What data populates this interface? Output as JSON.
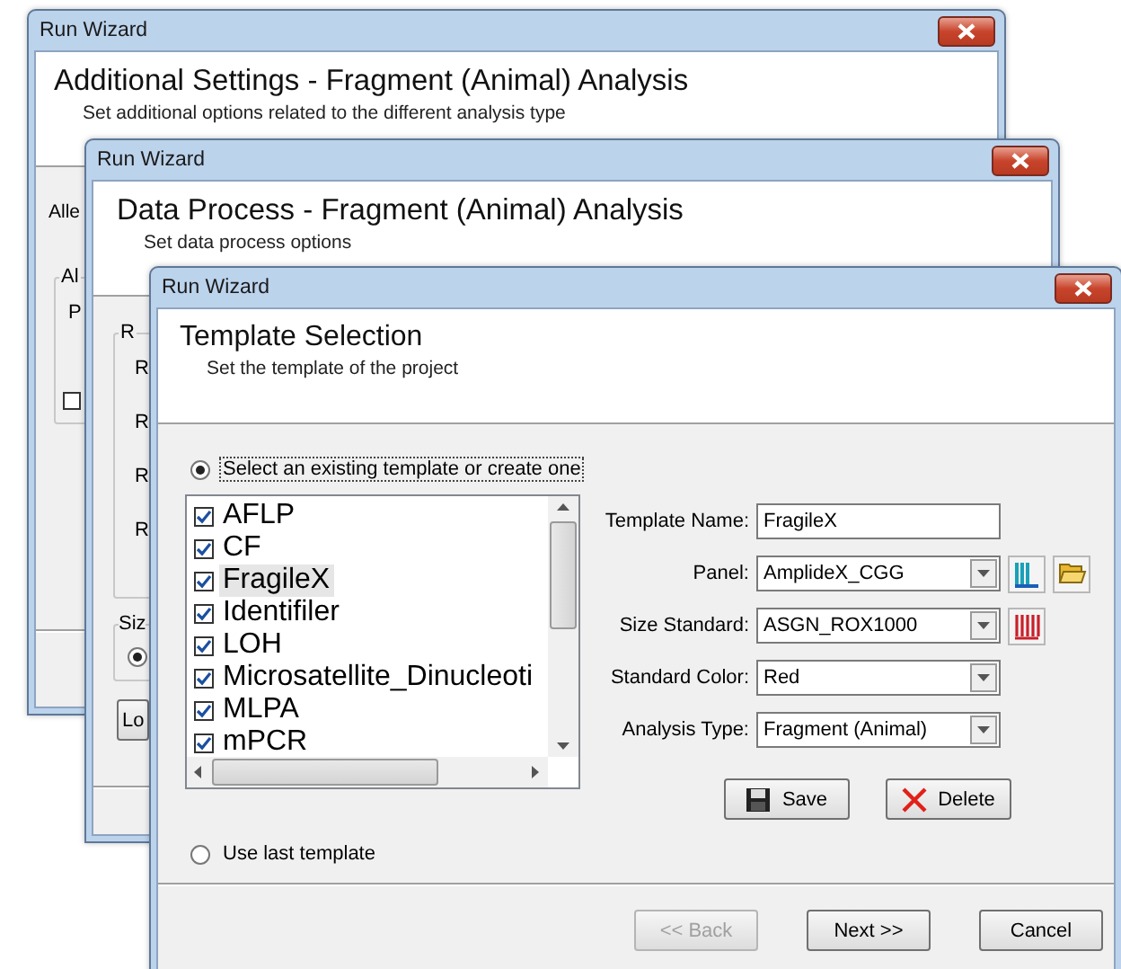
{
  "settings_window": {
    "title": "Run Wizard",
    "heading": "Additional Settings - Fragment (Animal) Analysis",
    "subtitle": "Set additional options related to the different analysis type",
    "label": "Alle",
    "group": {
      "legend": "Al",
      "label": "P",
      "checked": false
    }
  },
  "process_window": {
    "title": "Run Wizard",
    "heading": "Data Process - Fragment (Animal) Analysis",
    "subtitle": "Set data process options",
    "group": {
      "legend": "R",
      "items": [
        "R",
        "R",
        "R",
        "R"
      ]
    },
    "size_group": {
      "legend": "Siz",
      "selected": true
    },
    "button": "Lo"
  },
  "template_window": {
    "title": "Run Wizard",
    "heading": "Template Selection",
    "subtitle": "Set the template of the project",
    "existing_option": {
      "label": "Select an existing template or create one",
      "selected": true
    },
    "templates": [
      {
        "name": "AFLP",
        "checked": true,
        "selected": false
      },
      {
        "name": "CF",
        "checked": true,
        "selected": false
      },
      {
        "name": "FragileX",
        "checked": true,
        "selected": true
      },
      {
        "name": "Identifiler",
        "checked": true,
        "selected": false
      },
      {
        "name": "LOH",
        "checked": true,
        "selected": false
      },
      {
        "name": "Microsatellite_Dinucleoti",
        "checked": true,
        "selected": false
      },
      {
        "name": "MLPA",
        "checked": true,
        "selected": false
      },
      {
        "name": "mPCR",
        "checked": true,
        "selected": false
      }
    ],
    "fields": [
      {
        "kind": "text",
        "label": "Template Name:",
        "value": "FragileX"
      },
      {
        "kind": "combo",
        "label": "Panel:",
        "value": "AmplideX_CGG",
        "tools": [
          {
            "kind": "panel"
          },
          {
            "kind": "folder"
          }
        ]
      },
      {
        "kind": "combo",
        "label": "Size Standard:",
        "value": "ASGN_ROX1000",
        "tools": [
          {
            "kind": "ladder"
          }
        ]
      },
      {
        "kind": "combo",
        "label": "Standard Color:",
        "value": "Red"
      },
      {
        "kind": "combo",
        "label": "Analysis Type:",
        "value": "Fragment (Animal)"
      }
    ],
    "actions": [
      {
        "kind": "save",
        "label": "Save"
      },
      {
        "kind": "delete",
        "label": "Delete"
      }
    ],
    "last_option": {
      "label": "Use last template",
      "selected": false
    },
    "nav_buttons": [
      {
        "label": "<< Back",
        "disabled": true
      },
      {
        "label": "Next >>",
        "disabled": false
      },
      {
        "label": "Cancel",
        "disabled": false
      }
    ]
  }
}
